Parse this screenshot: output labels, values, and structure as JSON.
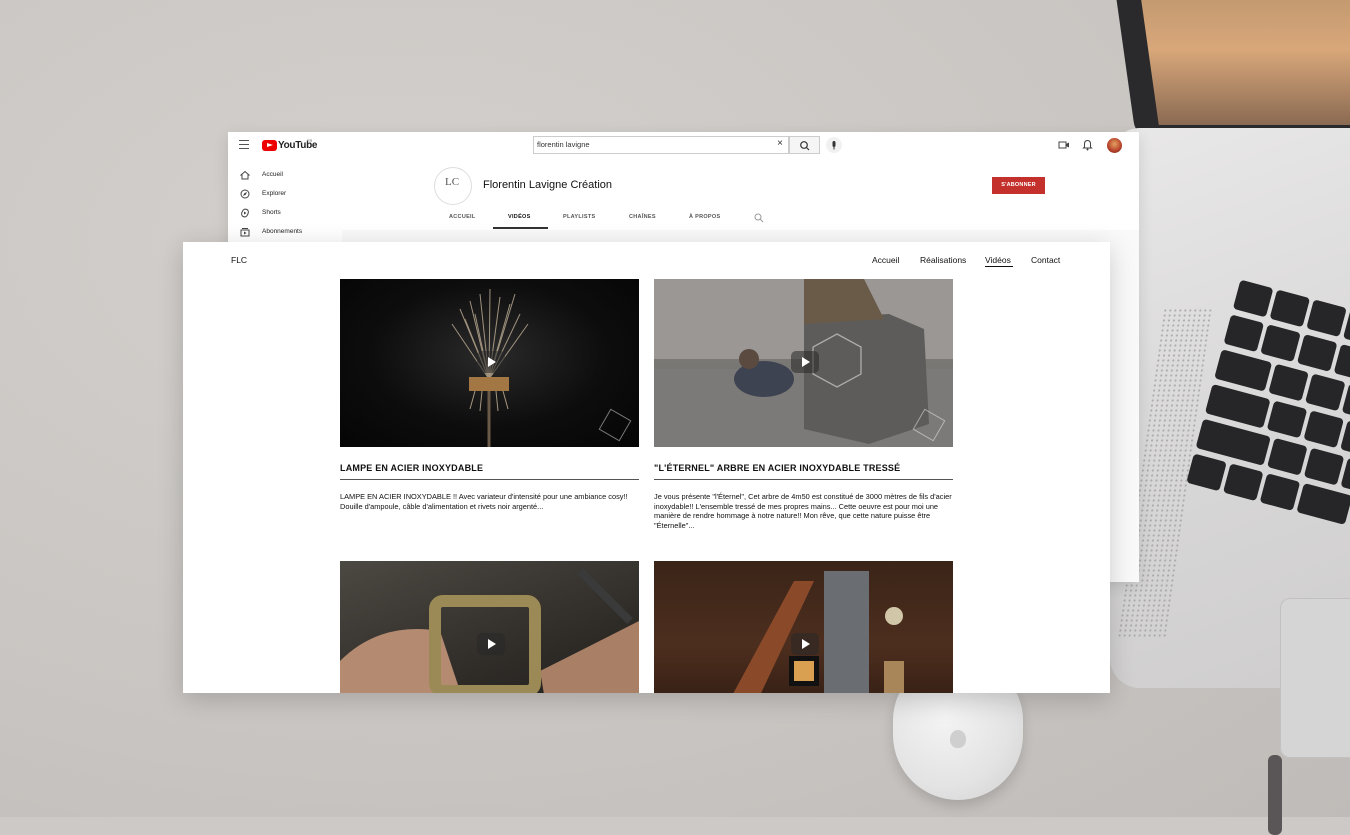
{
  "youtube": {
    "logo_text": "YouTube",
    "region": "FR",
    "search": {
      "value": "florentin lavigne"
    },
    "sidebar": [
      {
        "label": "Accueil",
        "icon": "home-icon"
      },
      {
        "label": "Explorer",
        "icon": "compass-icon"
      },
      {
        "label": "Shorts",
        "icon": "shorts-icon"
      },
      {
        "label": "Abonnements",
        "icon": "subscriptions-icon"
      }
    ],
    "channel": {
      "name": "Florentin Lavigne Création",
      "subscribe_label": "S'ABONNER",
      "tabs": [
        "ACCUEIL",
        "VIDÉOS",
        "PLAYLISTS",
        "CHAÎNES",
        "À PROPOS"
      ],
      "active_tab": "VIDÉOS"
    }
  },
  "site": {
    "brand": "FLC",
    "nav": [
      "Accueil",
      "Réalisations",
      "Vidéos",
      "Contact"
    ],
    "active_nav": "Vidéos",
    "videos": [
      {
        "title": "LAMPE EN ACIER INOXYDABLE",
        "description": "LAMPE EN ACIER INOXYDABLE !! Avec variateur d'intensité pour une ambiance cosy!! Douille d'ampoule, câble d'alimentation et rivets noir argenté..."
      },
      {
        "title": "\"L'ÉTERNEL\" ARBRE EN ACIER INOXYDABLE TRESSÉ",
        "description": "Je vous présente \"l'Éternel\", Cet arbre de 4m50 est constitué de 3000 mètres de fils d'acier inoxydable!! L'ensemble tressé de mes propres mains... Cette oeuvre est pour moi une manière de rendre hommage à notre nature!! Mon rêve, que cette nature puisse être \"Éternelle\"..."
      },
      {
        "title": "",
        "description": ""
      },
      {
        "title": "",
        "description": ""
      }
    ]
  },
  "colors": {
    "subscribe": "#c4302b",
    "youtube_red": "#ee0000"
  }
}
